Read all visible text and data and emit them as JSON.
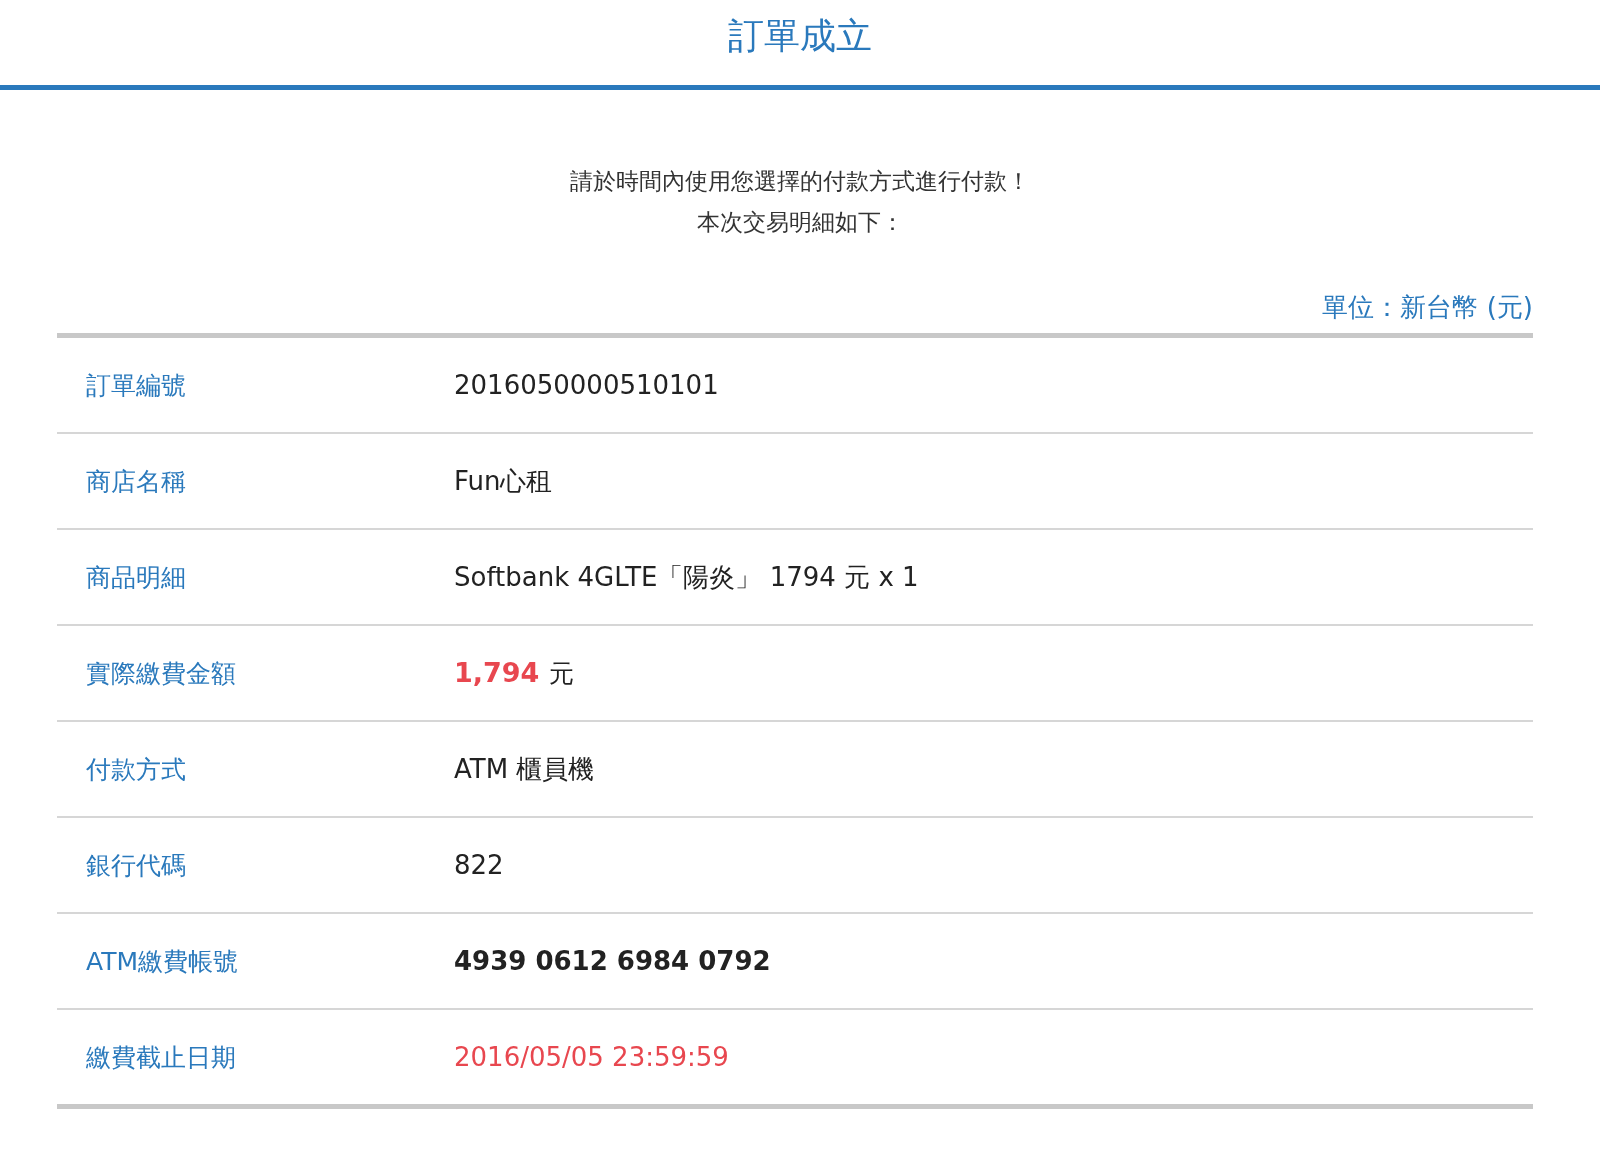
{
  "header": {
    "title": "訂單成立"
  },
  "message": [
    "請於時間內使用您選擇的付款方式進行付款！",
    "本次交易明細如下："
  ],
  "unit": "單位：新台幣 (元)",
  "rows": [
    {
      "label": "訂單編號",
      "kind": "text",
      "value": "2016050000510101"
    },
    {
      "label": "商店名稱",
      "kind": "text",
      "value": "Fun心租"
    },
    {
      "label": "商品明細",
      "kind": "text",
      "value": "Softbank 4GLTE「陽炎」 1794 元 x 1"
    },
    {
      "label": "實際繳費金額",
      "kind": "amount",
      "value": "1,794",
      "suffix": "元"
    },
    {
      "label": "付款方式",
      "kind": "text",
      "value": "ATM 櫃員機"
    },
    {
      "label": "銀行代碼",
      "kind": "text",
      "value": "822"
    },
    {
      "label": "ATM繳費帳號",
      "kind": "strong",
      "value": "4939 0612 6984 0792"
    },
    {
      "label": "繳費截止日期",
      "kind": "alert",
      "value": "2016/05/05 23:59:59"
    }
  ]
}
